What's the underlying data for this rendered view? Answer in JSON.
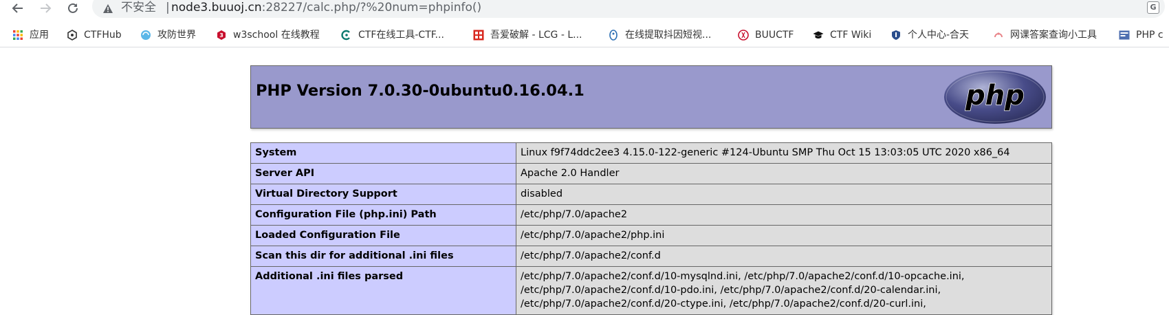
{
  "browser": {
    "security_label": "不安全",
    "separator": "|",
    "url_host": "node3.buuoj.cn",
    "url_rest": ":28227/calc.php/?%20num=phpinfo()",
    "translate_glyph": "G"
  },
  "bookmarks": [
    {
      "label": "应用",
      "icon": "apps-grid-icon"
    },
    {
      "label": "CTFHub",
      "icon": "ctfhub-icon"
    },
    {
      "label": "攻防世界",
      "icon": "adworld-icon"
    },
    {
      "label": "w3school 在线教程",
      "icon": "w3school-icon"
    },
    {
      "label": "CTF在线工具-CTF...",
      "icon": "ctftools-icon"
    },
    {
      "label": "吾爱破解 - LCG - L...",
      "icon": "52pojie-icon"
    },
    {
      "label": "在线提取抖因短视...",
      "icon": "douyin-icon"
    },
    {
      "label": "BUUCTF",
      "icon": "buuctf-icon"
    },
    {
      "label": "CTF Wiki",
      "icon": "ctfwiki-icon"
    },
    {
      "label": "个人中心-合天",
      "icon": "hetian-icon"
    },
    {
      "label": "网课答案查询小工具",
      "icon": "wangke-icon"
    },
    {
      "label": "PHP c",
      "icon": "php-manual-icon"
    }
  ],
  "phpinfo": {
    "version_title": "PHP Version 7.0.30-0ubuntu0.16.04.1",
    "logo_text": "php",
    "rows": [
      {
        "key": "System",
        "value": [
          "Linux f9f74ddc2ee3 4.15.0-122-generic #124-Ubuntu SMP Thu Oct 15 13:03:05 UTC 2020 x86_64"
        ]
      },
      {
        "key": "Server API",
        "value": [
          "Apache 2.0 Handler"
        ]
      },
      {
        "key": "Virtual Directory Support",
        "value": [
          "disabled"
        ]
      },
      {
        "key": "Configuration File (php.ini) Path",
        "value": [
          "/etc/php/7.0/apache2"
        ]
      },
      {
        "key": "Loaded Configuration File",
        "value": [
          "/etc/php/7.0/apache2/php.ini"
        ]
      },
      {
        "key": "Scan this dir for additional .ini files",
        "value": [
          "/etc/php/7.0/apache2/conf.d"
        ]
      },
      {
        "key": "Additional .ini files parsed",
        "value": [
          "/etc/php/7.0/apache2/conf.d/10-mysqlnd.ini, /etc/php/7.0/apache2/conf.d/10-opcache.ini,",
          "/etc/php/7.0/apache2/conf.d/10-pdo.ini, /etc/php/7.0/apache2/conf.d/20-calendar.ini,",
          "/etc/php/7.0/apache2/conf.d/20-ctype.ini, /etc/php/7.0/apache2/conf.d/20-curl.ini,"
        ]
      }
    ]
  },
  "colors": {
    "header_bg": "#9999cc",
    "key_bg": "#ccccff",
    "value_bg": "#dddddd",
    "border": "#666666"
  }
}
